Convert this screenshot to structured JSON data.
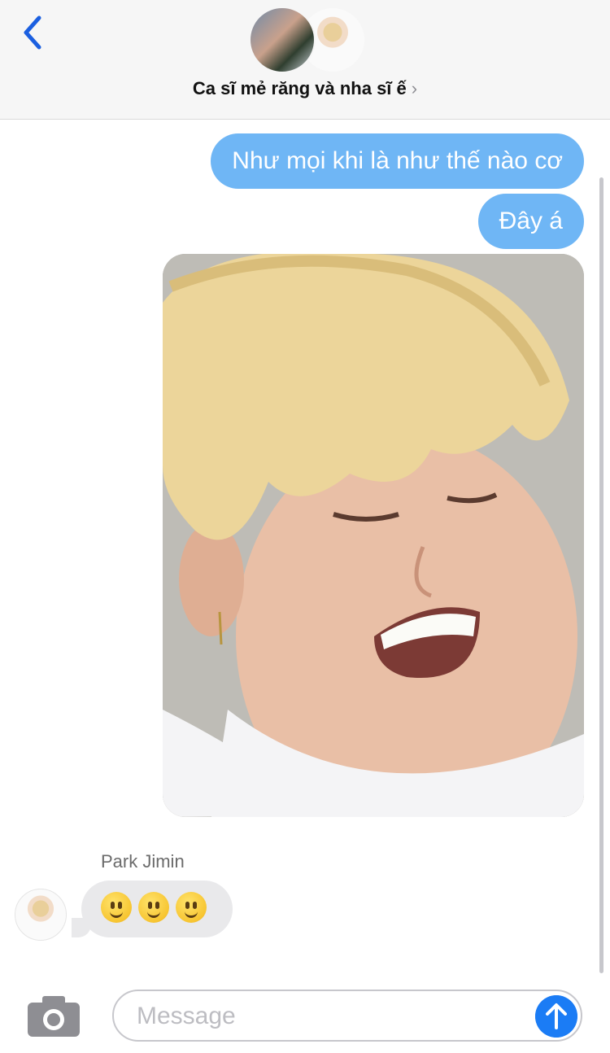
{
  "header": {
    "title": "Ca sĩ mẻ răng và nha sĩ ế",
    "chevron": "›",
    "accent_color": "#1b5fe0"
  },
  "messages": {
    "outgoing": [
      {
        "text": "Như mọi khi là như thế nào cơ"
      },
      {
        "text": "Đây á"
      }
    ],
    "incoming": {
      "sender": "Park Jimin",
      "emoji": "🙂🙂🙂"
    }
  },
  "composer": {
    "placeholder": "Message",
    "camera_icon": "camera-icon",
    "send_icon": "arrow-up-icon",
    "send_color": "#1b7cf5"
  },
  "colors": {
    "outgoing_bubble": "#6fb6f5",
    "incoming_bubble": "#e9e9eb"
  }
}
